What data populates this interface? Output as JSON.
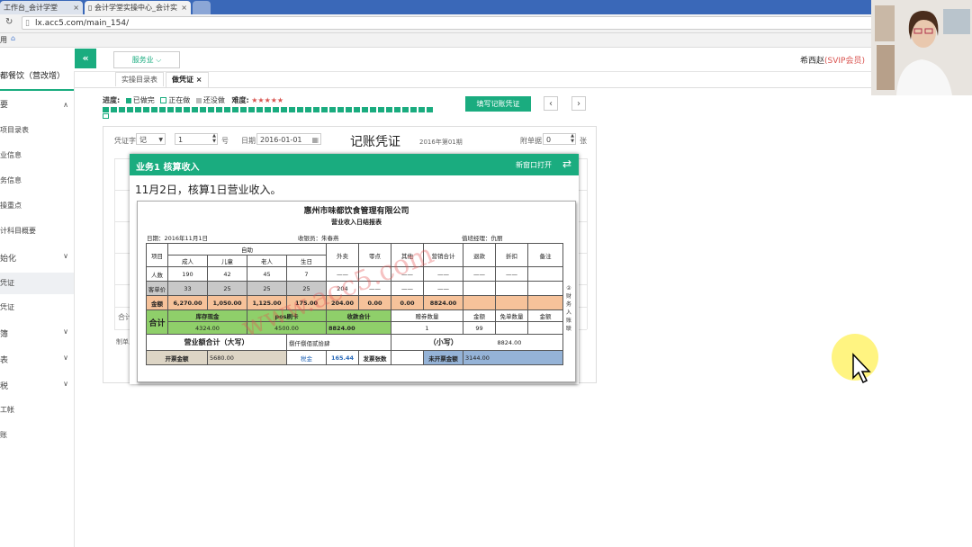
{
  "browser": {
    "tabs": [
      {
        "label": "工作台_会计学堂"
      },
      {
        "label": "会计学堂实操中心_会计实"
      }
    ],
    "url": "lx.acc5.com/main_154/",
    "bookmark_glyph": "用"
  },
  "header": {
    "collapse_label": "«",
    "service_dropdown": "服务业 ⌵",
    "user_name": "希西赵",
    "user_level": "(SVIP会员)"
  },
  "sidebar": {
    "company": "都餐饮（营改增）",
    "items": [
      {
        "label": "要",
        "chevron": "∧"
      },
      {
        "label": "项目录表"
      },
      {
        "label": "业信息"
      },
      {
        "label": "务信息"
      },
      {
        "label": "操重点"
      },
      {
        "label": "计科目概要"
      },
      {
        "label": "始化",
        "chevron": "∨"
      },
      {
        "label": "凭证",
        "selected": true
      },
      {
        "label": "凭证"
      },
      {
        "label": "簿",
        "chevron": "∨"
      },
      {
        "label": "表",
        "chevron": "∨"
      },
      {
        "label": "税",
        "chevron": "∨"
      },
      {
        "label": "工帐"
      },
      {
        "label": "账"
      }
    ]
  },
  "page_tabs": [
    {
      "label": "实操目录表"
    },
    {
      "label": "做凭证 ×",
      "active": true
    }
  ],
  "progress": {
    "label": "进度:",
    "done": "已做完",
    "doing": "正在做",
    "todo": "还没做",
    "difficulty_label": "难度:",
    "difficulty_stars": "★★★★★"
  },
  "toolbar": {
    "fill_button": "填写记账凭证",
    "prev": "‹",
    "next": "›"
  },
  "voucher": {
    "type_label": "凭证字",
    "type_value": "记",
    "number_value": "1",
    "number_unit": "号",
    "date_label": "日期",
    "date_value": "2016-01-01",
    "title": "记账凭证",
    "period": "2016年第01期",
    "attach_label": "附单据",
    "attach_value": "0",
    "attach_unit": "张",
    "total_label": "合计",
    "maker_label": "制单人"
  },
  "modal": {
    "title": "业务1 核算收入",
    "new_window": "新窗口打开",
    "swap_icon": "⇄",
    "description": "11月2日，核算1日营业收入。"
  },
  "doc": {
    "company": "惠州市味都饮食管理有限公司",
    "subtitle": "营业收入日结报表",
    "date_label": "日期：",
    "date_value": "2016年11月1日",
    "cashier_label": "收银员：",
    "cashier_value": "朱春燕",
    "manager_label": "值班经理：",
    "manager_value": "仇丽",
    "header_row1": [
      "项目",
      "自助",
      "外卖",
      "零点",
      "其他",
      "营销合计",
      "退款",
      "折扣",
      "备注"
    ],
    "header_row2": [
      "成人",
      "儿童",
      "老人",
      "生日"
    ],
    "row_people": [
      "人数",
      "190",
      "42",
      "45",
      "7",
      "——",
      "",
      "——",
      "——",
      "——",
      "——",
      ""
    ],
    "row_avg": [
      "客单价",
      "33",
      "25",
      "25",
      "25",
      "204",
      "——",
      "——",
      "——",
      "",
      "",
      ""
    ],
    "row_amount": [
      "金额",
      "6,270.00",
      "1,050.00",
      "1,125.00",
      "175.00",
      "204.00",
      "0.00",
      "0.00",
      "8824.00",
      "",
      "",
      ""
    ],
    "total_label": "合计",
    "total_h": [
      "库存现金",
      "pos刷卡",
      "收款合计",
      "赠券数量",
      "金额",
      "免单数量",
      "金额"
    ],
    "total_v": [
      "4324.00",
      "4500.00",
      "8824.00",
      "1",
      "99",
      "",
      ""
    ],
    "daxie_label": "营业额合计（大写）",
    "daxie_value": "捌仟捌佰贰拾肆",
    "xiaoxie_label": "（小写）",
    "xiaoxie_value": "8824.00",
    "invoice_label": "开票金额",
    "invoice_value": "5680.00",
    "tax_label": "税金",
    "tax_value": "165.44",
    "invoice_count_label": "发票张数",
    "invoice_count_value": "",
    "uninvoiced_label": "未开票金额",
    "uninvoiced_value": "3144.00",
    "side_note": "②财务入账联",
    "watermark": "www.acc5.com"
  },
  "colors": {
    "accent": "#1aac7f",
    "orange_row": "#f6c29a",
    "green_row": "#8fcf6a",
    "blue_cell": "#95b3d7"
  }
}
